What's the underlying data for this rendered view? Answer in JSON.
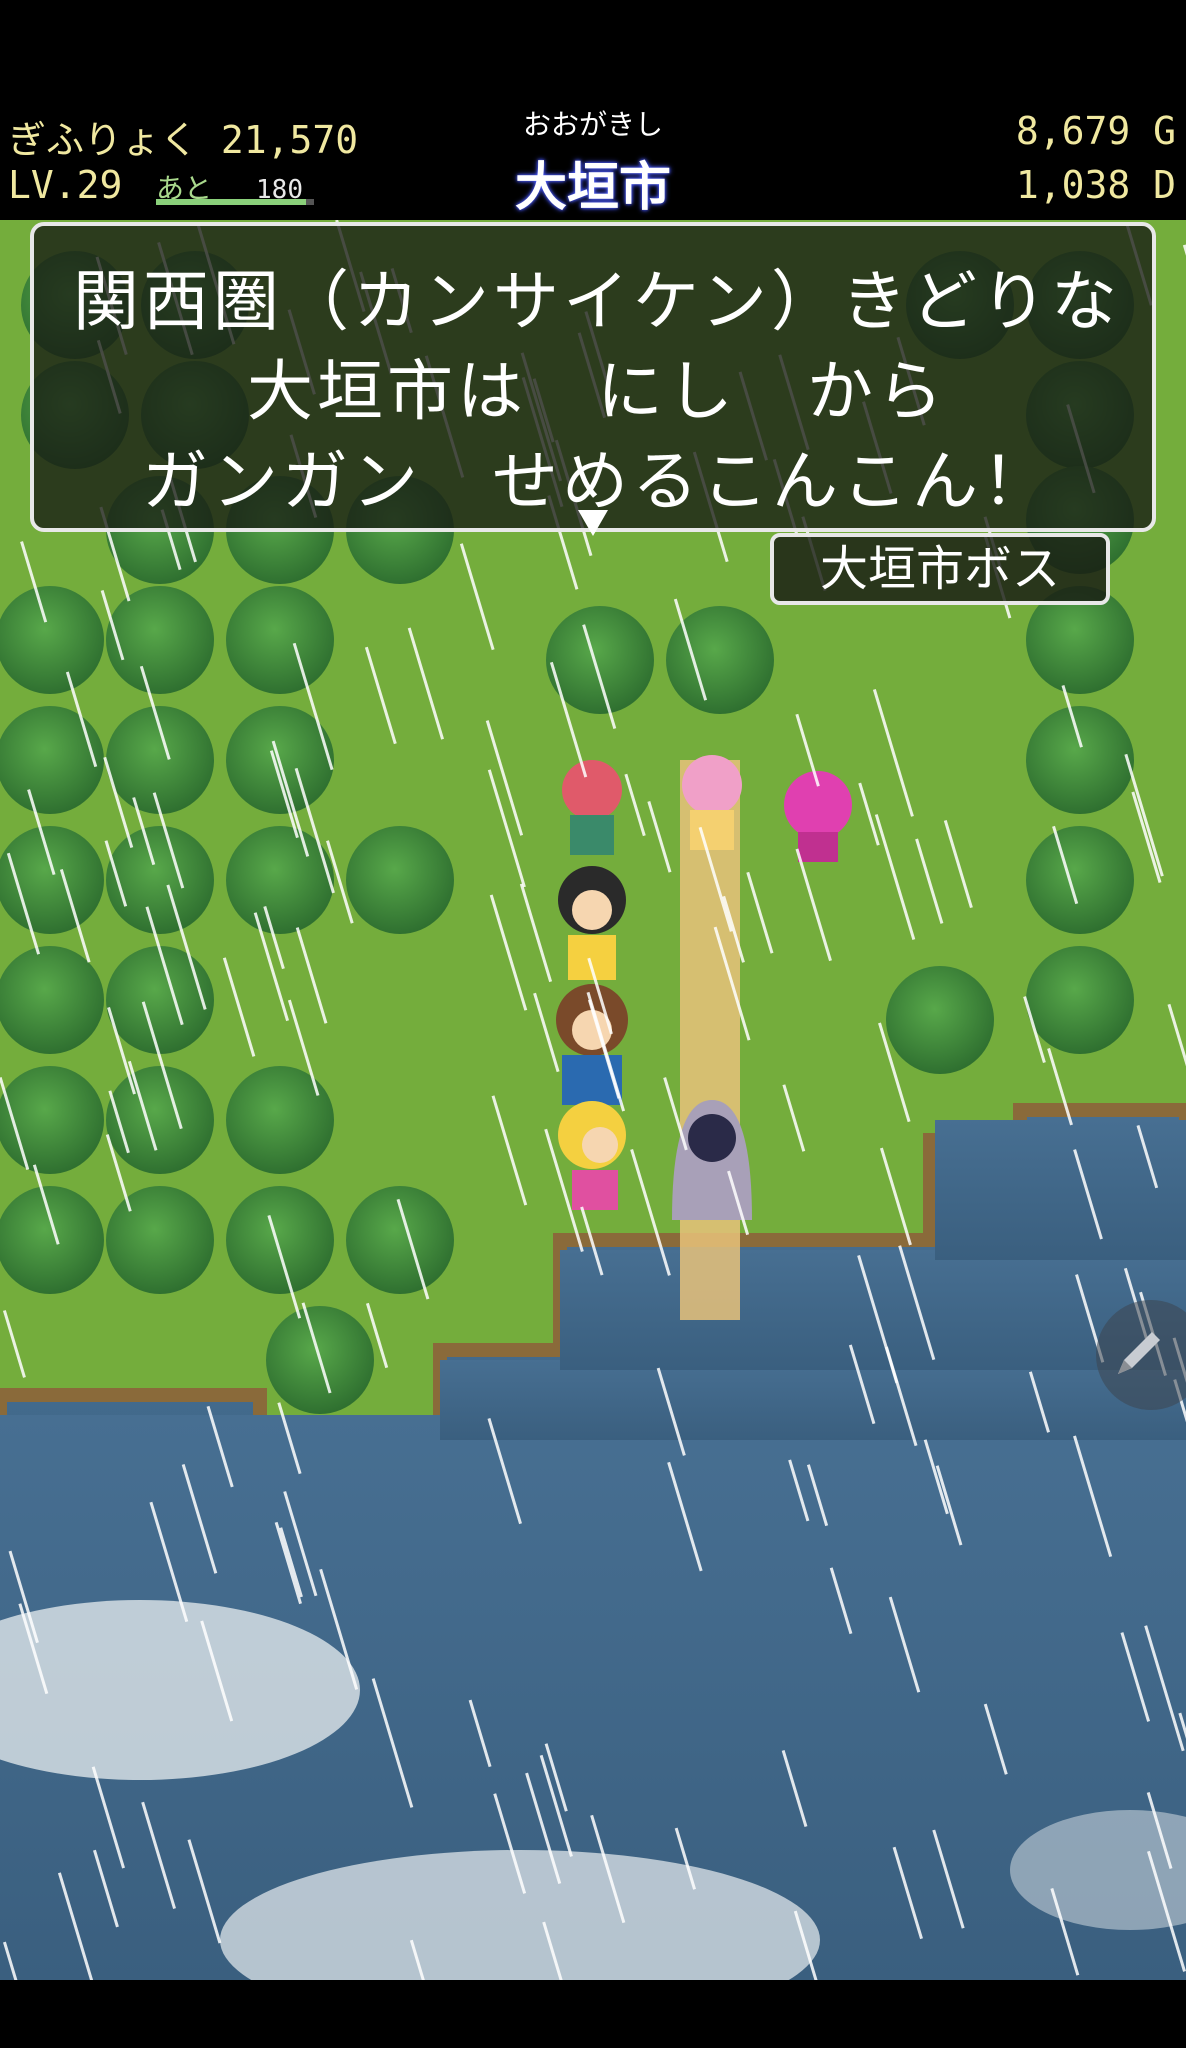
{
  "hud": {
    "power_label": "ぎふりょく",
    "power_value": "21,570",
    "level": "LV.29",
    "exp_remaining_label": "あと",
    "exp_remaining_value": "180",
    "exp_progress": 0.95,
    "city_reading": "おおがきし",
    "city_name": "大垣市",
    "gold_value": "8,679",
    "gold_unit": "G",
    "dia_value": "1,038",
    "dia_unit": "D"
  },
  "dialog": {
    "line1": "関西圏（カンサイケン）きどりな",
    "line2": "大垣市は　にし　から",
    "line3": "ガンガン　せめるこんこん！"
  },
  "speaker": {
    "name": "大垣市ボス"
  },
  "icons": {
    "menu": "pencil-icon",
    "next": "triangle-down-icon"
  },
  "colors": {
    "grass": "#6aa33a",
    "tree": "#3f8a3a",
    "water": "#3f6585",
    "path": "#e8c27a",
    "hud_text": "#f0e8a0",
    "city_glow": "#4a5aff"
  }
}
